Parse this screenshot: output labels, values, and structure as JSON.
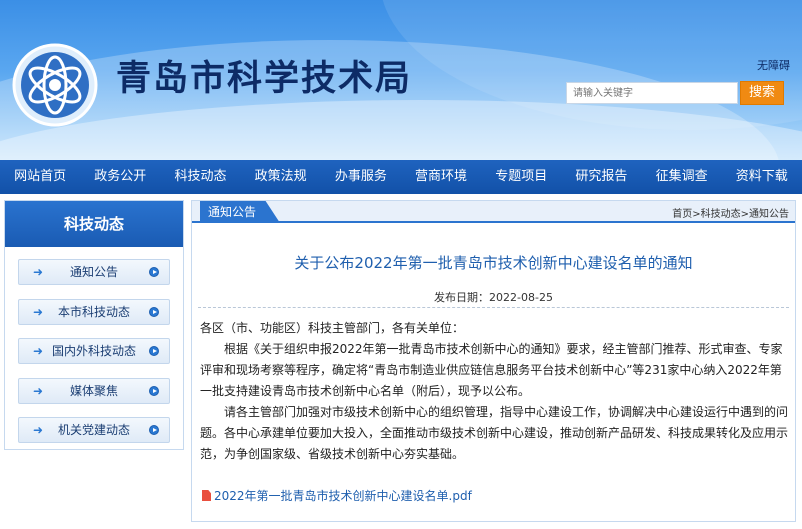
{
  "header": {
    "site_title": "青岛市科学技术局",
    "accessibility_link": "无障碍",
    "search": {
      "placeholder": "请输入关键字",
      "button_label": "搜索"
    }
  },
  "nav": {
    "items": [
      "网站首页",
      "政务公开",
      "科技动态",
      "政策法规",
      "办事服务",
      "营商环境",
      "专题项目",
      "研究报告",
      "征集调查",
      "资料下载"
    ]
  },
  "sidebar": {
    "title": "科技动态",
    "items": [
      "通知公告",
      "本市科技动态",
      "国内外科技动态",
      "媒体聚焦",
      "机关党建动态"
    ]
  },
  "content": {
    "section_tab": "通知公告",
    "breadcrumb": "首页>科技动态>通知公告",
    "title": "关于公布2022年第一批青岛市技术创新中心建设名单的通知",
    "publish_date": "发布日期：2022-08-25",
    "salutation": "各区（市、功能区）科技主管部门，各有关单位：",
    "paragraphs": [
      "根据《关于组织申报2022年第一批青岛市技术创新中心的通知》要求，经主管部门推荐、形式审查、专家评审和现场考察等程序，确定将“青岛市制造业供应链信息服务平台技术创新中心”等231家中心纳入2022年第一批支持建设青岛市技术创新中心名单（附后），现予以公布。",
      "请各主管部门加强对市级技术创新中心的组织管理，指导中心建设工作，协调解决中心建设运行中遇到的问题。各中心承建单位要加大投入，全面推动市级技术创新中心建设，推动创新产品研发、科技成果转化及应用示范，为争创国家级、省级技术创新中心夯实基础。"
    ],
    "attachment": "2022年第一批青岛市技术创新中心建设名单.pdf"
  },
  "colors": {
    "nav_bg": "#1251a8",
    "accent_blue": "#2b74cf",
    "search_button": "#f08a12",
    "title_text": "#1f5fae"
  },
  "icons": [
    "science-atom-logo-icon",
    "arrow-right-icon",
    "circle-play-icon",
    "pdf-file-icon"
  ]
}
